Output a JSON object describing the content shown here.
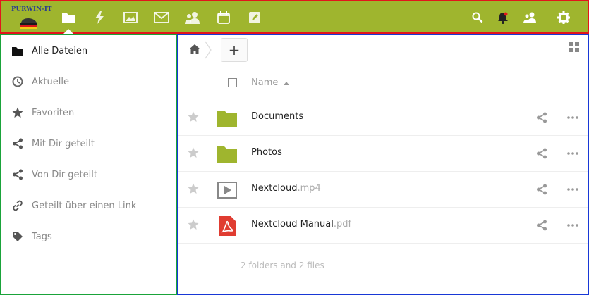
{
  "header": {
    "logo_text": "PURWIN-IT",
    "apps": [
      {
        "name": "files",
        "icon": "folder-icon",
        "active": true
      },
      {
        "name": "activity",
        "icon": "lightning-icon"
      },
      {
        "name": "gallery",
        "icon": "image-icon"
      },
      {
        "name": "mail",
        "icon": "mail-icon"
      },
      {
        "name": "contacts",
        "icon": "contacts-icon"
      },
      {
        "name": "calendar",
        "icon": "calendar-icon"
      },
      {
        "name": "notes",
        "icon": "edit-icon"
      }
    ],
    "right_icons": [
      "search-icon",
      "notifications-icon",
      "contacts-menu-icon",
      "settings-gear-icon"
    ],
    "colors": {
      "bar": "#9fb52e",
      "bell": "#222222",
      "bell_badge": "#e3151b"
    }
  },
  "sidebar": {
    "items": [
      {
        "label": "Alle Dateien",
        "icon": "folder-icon",
        "active": true
      },
      {
        "label": "Aktuelle",
        "icon": "clock-icon"
      },
      {
        "label": "Favoriten",
        "icon": "star-icon"
      },
      {
        "label": "Mit Dir geteilt",
        "icon": "share-icon"
      },
      {
        "label": "Von Dir geteilt",
        "icon": "share-icon"
      },
      {
        "label": "Geteilt über einen Link",
        "icon": "link-icon"
      },
      {
        "label": "Tags",
        "icon": "tag-icon"
      }
    ]
  },
  "main": {
    "breadcrumb_home_icon": "home-icon",
    "new_button_label": "+",
    "column_name": "Name",
    "files": [
      {
        "name": "Documents",
        "ext": "",
        "type": "folder"
      },
      {
        "name": "Photos",
        "ext": "",
        "type": "folder"
      },
      {
        "name": "Nextcloud",
        "ext": ".mp4",
        "type": "video"
      },
      {
        "name": "Nextcloud Manual",
        "ext": ".pdf",
        "type": "pdf"
      }
    ],
    "summary": "2 folders and 2 files",
    "colors": {
      "folder": "#9fb52e",
      "pdf": "#e03c31"
    }
  }
}
